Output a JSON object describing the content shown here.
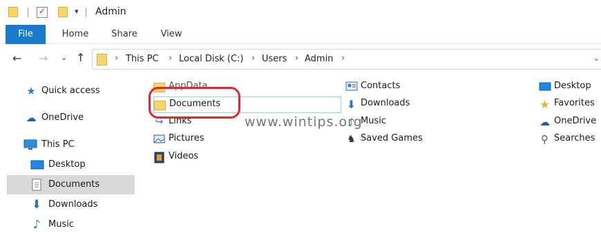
{
  "window": {
    "title": "Admin"
  },
  "ribbon": {
    "tabs": [
      "File",
      "Home",
      "Share",
      "View"
    ]
  },
  "address": {
    "crumbs": [
      "This PC",
      "Local Disk (C:)",
      "Users",
      "Admin"
    ]
  },
  "nav": {
    "quick_access": "Quick access",
    "onedrive": "OneDrive",
    "this_pc": "This PC",
    "desktop": "Desktop",
    "documents": "Documents",
    "downloads": "Downloads",
    "music": "Music"
  },
  "items": {
    "appdata": "AppData",
    "documents": "Documents",
    "links": "Links",
    "pictures": "Pictures",
    "videos": "Videos",
    "contacts": "Contacts",
    "downloads": "Downloads",
    "music": "Music",
    "saved_games": "Saved Games",
    "desktop": "Desktop",
    "favorites": "Favorites",
    "onedrive": "OneDrive",
    "searches": "Searches"
  },
  "watermark": "www.wintips.org",
  "colors": {
    "accent": "#1979ca",
    "selection": "#d9d9d9",
    "highlight_ring": "#e3262e",
    "folder": "#f7d56b"
  }
}
